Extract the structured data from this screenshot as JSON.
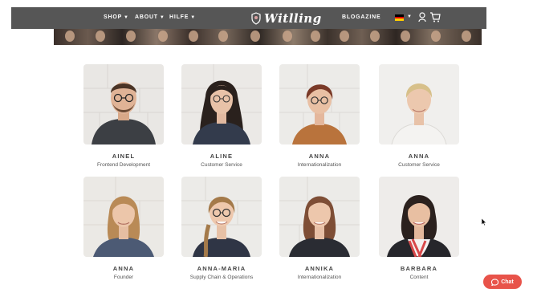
{
  "nav": {
    "shop": "SHOP",
    "about": "ABOUT",
    "hilfe": "HILFE",
    "logo": "Witlling",
    "blogazine": "BLOGAZINE"
  },
  "team": [
    {
      "name": "AINEL",
      "role": "Frontend Development"
    },
    {
      "name": "ALINE",
      "role": "Customer Service"
    },
    {
      "name": "ANNA",
      "role": "Internationalization"
    },
    {
      "name": "ANNA",
      "role": "Customer Service"
    },
    {
      "name": "ANNA",
      "role": "Founder"
    },
    {
      "name": "ANNA-MARIA",
      "role": "Supply Chain & Operations"
    },
    {
      "name": "ANNIKA",
      "role": "Internationalization"
    },
    {
      "name": "BARBARA",
      "role": "Content"
    }
  ],
  "chat": {
    "label": "Chat"
  },
  "colors": {
    "navbar": "#565656",
    "chat": "#e8534a"
  }
}
